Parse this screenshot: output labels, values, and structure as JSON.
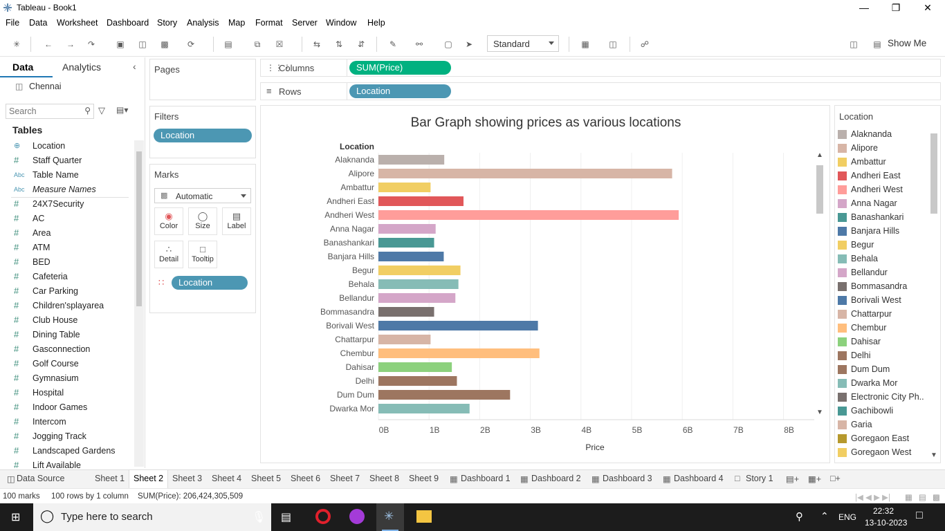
{
  "window": {
    "title": "Tableau - Book1"
  },
  "menu": [
    "File",
    "Data",
    "Worksheet",
    "Dashboard",
    "Story",
    "Analysis",
    "Map",
    "Format",
    "Server",
    "Window",
    "Help"
  ],
  "toolbar": {
    "fit_select": "Standard",
    "show_me": "Show Me"
  },
  "data_pane": {
    "tabs": [
      "Data",
      "Analytics"
    ],
    "datasource": "Chennai",
    "search_placeholder": "Search",
    "section_title": "Tables",
    "fields": [
      {
        "icon": "globe",
        "type": "geo",
        "name": "Location"
      },
      {
        "icon": "#",
        "type": "num",
        "name": "Staff Quarter"
      },
      {
        "icon": "Abc",
        "type": "str",
        "name": "Table Name"
      },
      {
        "icon": "Abc",
        "type": "str",
        "name": "Measure Names"
      },
      {
        "icon": "#",
        "type": "num",
        "name": "24X7Security"
      },
      {
        "icon": "#",
        "type": "num",
        "name": "AC"
      },
      {
        "icon": "#",
        "type": "num",
        "name": "Area"
      },
      {
        "icon": "#",
        "type": "num",
        "name": "ATM"
      },
      {
        "icon": "#",
        "type": "num",
        "name": "BED"
      },
      {
        "icon": "#",
        "type": "num",
        "name": "Cafeteria"
      },
      {
        "icon": "#",
        "type": "num",
        "name": "Car Parking"
      },
      {
        "icon": "#",
        "type": "num",
        "name": "Children'splayarea"
      },
      {
        "icon": "#",
        "type": "num",
        "name": "Club House"
      },
      {
        "icon": "#",
        "type": "num",
        "name": "Dining Table"
      },
      {
        "icon": "#",
        "type": "num",
        "name": "Gasconnection"
      },
      {
        "icon": "#",
        "type": "num",
        "name": "Golf Course"
      },
      {
        "icon": "#",
        "type": "num",
        "name": "Gymnasium"
      },
      {
        "icon": "#",
        "type": "num",
        "name": "Hospital"
      },
      {
        "icon": "#",
        "type": "num",
        "name": "Indoor Games"
      },
      {
        "icon": "#",
        "type": "num",
        "name": "Intercom"
      },
      {
        "icon": "#",
        "type": "num",
        "name": "Jogging Track"
      },
      {
        "icon": "#",
        "type": "num",
        "name": "Landscaped Gardens"
      },
      {
        "icon": "#",
        "type": "num",
        "name": "Lift Available"
      }
    ]
  },
  "cards": {
    "pages": "Pages",
    "filters": "Filters",
    "filter_pill": "Location",
    "marks": "Marks",
    "mark_type": "Automatic",
    "mark_buttons": [
      "Color",
      "Size",
      "Label",
      "Detail",
      "Tooltip"
    ],
    "color_pill": "Location"
  },
  "shelves": {
    "columns_label": "Columns",
    "columns_pill": "SUM(Price)",
    "rows_label": "Rows",
    "rows_pill": "Location"
  },
  "chart_data": {
    "type": "bar",
    "orientation": "horizontal",
    "title": "Bar  Graph showing prices as various locations",
    "row_header": "Location",
    "xlabel": "Price",
    "xlim": [
      0,
      8.5
    ],
    "x_unit": "billions",
    "x_ticks": [
      "0B",
      "1B",
      "2B",
      "3B",
      "4B",
      "5B",
      "6B",
      "7B",
      "8B"
    ],
    "categories": [
      "Alaknanda",
      "Alipore",
      "Ambattur",
      "Andheri East",
      "Andheri West",
      "Anna Nagar",
      "Banashankari",
      "Banjara Hills",
      "Begur",
      "Behala",
      "Bellandur",
      "Bommasandra",
      "Borivali West",
      "Chattarpur",
      "Chembur",
      "Dahisar",
      "Delhi",
      "Dum Dum",
      "Dwarka Mor"
    ],
    "values": [
      1.3,
      5.8,
      1.03,
      1.68,
      5.93,
      1.13,
      1.1,
      1.29,
      1.62,
      1.58,
      1.52,
      1.1,
      3.15,
      1.03,
      3.18,
      1.45,
      1.55,
      2.6,
      1.8
    ],
    "colors": [
      "#bab0ac",
      "#d7b5a6",
      "#f1ce63",
      "#e15759",
      "#ff9d9a",
      "#d4a6c8",
      "#499894",
      "#4e79a7",
      "#f1ce63",
      "#86bcb6",
      "#d4a6c8",
      "#79706e",
      "#4e79a7",
      "#d7b5a6",
      "#ffbe7d",
      "#8cd17d",
      "#9d7660",
      "#9d7660",
      "#86bcb6"
    ]
  },
  "legend": {
    "title": "Location",
    "items": [
      {
        "label": "Alaknanda",
        "color": "#bab0ac"
      },
      {
        "label": "Alipore",
        "color": "#d7b5a6"
      },
      {
        "label": "Ambattur",
        "color": "#f1ce63"
      },
      {
        "label": "Andheri East",
        "color": "#e15759"
      },
      {
        "label": "Andheri West",
        "color": "#ff9d9a"
      },
      {
        "label": "Anna Nagar",
        "color": "#d4a6c8"
      },
      {
        "label": "Banashankari",
        "color": "#499894"
      },
      {
        "label": "Banjara Hills",
        "color": "#4e79a7"
      },
      {
        "label": "Begur",
        "color": "#f1ce63"
      },
      {
        "label": "Behala",
        "color": "#86bcb6"
      },
      {
        "label": "Bellandur",
        "color": "#d4a6c8"
      },
      {
        "label": "Bommasandra",
        "color": "#79706e"
      },
      {
        "label": "Borivali West",
        "color": "#4e79a7"
      },
      {
        "label": "Chattarpur",
        "color": "#d7b5a6"
      },
      {
        "label": "Chembur",
        "color": "#ffbe7d"
      },
      {
        "label": "Dahisar",
        "color": "#8cd17d"
      },
      {
        "label": "Delhi",
        "color": "#9d7660"
      },
      {
        "label": "Dum Dum",
        "color": "#9d7660"
      },
      {
        "label": "Dwarka Mor",
        "color": "#86bcb6"
      },
      {
        "label": "Electronic City Ph..",
        "color": "#79706e"
      },
      {
        "label": "Gachibowli",
        "color": "#499894"
      },
      {
        "label": "Garia",
        "color": "#d7b5a6"
      },
      {
        "label": "Goregaon East",
        "color": "#b6992d"
      },
      {
        "label": "Goregaon West",
        "color": "#f1ce63"
      }
    ]
  },
  "sheet_tabs": [
    "Data Source",
    "Sheet 1",
    "Sheet 2",
    "Sheet 3",
    "Sheet 4",
    "Sheet 5",
    "Sheet 6",
    "Sheet 7",
    "Sheet 8",
    "Sheet 9",
    "Dashboard 1",
    "Dashboard 2",
    "Dashboard 3",
    "Dashboard 4",
    "Story 1"
  ],
  "active_tab": "Sheet 2",
  "status": {
    "marks": "100 marks",
    "rows": "100 rows by 1 column",
    "sum": "SUM(Price): 206,424,305,509"
  },
  "taskbar": {
    "search_placeholder": "Type here to search",
    "lang": "ENG",
    "time": "22:32",
    "date": "13-10-2023"
  }
}
